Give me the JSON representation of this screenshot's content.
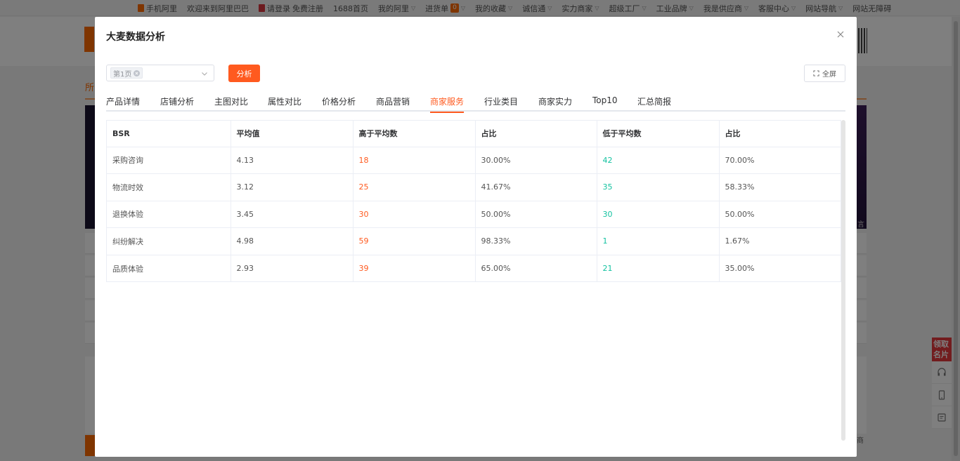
{
  "topbar": {
    "items": [
      "手机阿里",
      "欢迎来到阿里巴巴",
      "请登录",
      "免费注册",
      "1688首页",
      "我的阿里",
      "进货单",
      "我的收藏",
      "诚信通",
      "实力商家",
      "超级工厂",
      "工业品牌",
      "我是供应商",
      "客服中心",
      "网站导航",
      "网站无障碍"
    ],
    "cart_count": "0"
  },
  "background": {
    "tab_label": "所",
    "side_promo": "领取名片",
    "right_edge_label": "言",
    "bottom_right_label": "商"
  },
  "modal": {
    "title": "大麦数据分析",
    "page_select": {
      "tag": "第1页"
    },
    "analyze_label": "分析",
    "fullscreen_label": "全屏",
    "tabs": [
      {
        "label": "产品详情",
        "active": false
      },
      {
        "label": "店铺分析",
        "active": false
      },
      {
        "label": "主图对比",
        "active": false
      },
      {
        "label": "属性对比",
        "active": false
      },
      {
        "label": "价格分析",
        "active": false
      },
      {
        "label": "商品营销",
        "active": false
      },
      {
        "label": "商家服务",
        "active": true
      },
      {
        "label": "行业类目",
        "active": false
      },
      {
        "label": "商家实力",
        "active": false
      },
      {
        "label": "Top10",
        "active": false
      },
      {
        "label": "汇总简报",
        "active": false
      }
    ],
    "table": {
      "headers": [
        "BSR",
        "平均值",
        "高于平均数",
        "占比",
        "低于平均数",
        "占比"
      ],
      "rows": [
        [
          "采购咨询",
          "4.13",
          "18",
          "30.00%",
          "42",
          "70.00%"
        ],
        [
          "物流时效",
          "3.12",
          "25",
          "41.67%",
          "35",
          "58.33%"
        ],
        [
          "退换体验",
          "3.45",
          "30",
          "50.00%",
          "30",
          "50.00%"
        ],
        [
          "纠纷解决",
          "4.98",
          "59",
          "98.33%",
          "1",
          "1.67%"
        ],
        [
          "品质体验",
          "2.93",
          "39",
          "65.00%",
          "21",
          "35.00%"
        ]
      ]
    }
  },
  "colors": {
    "accent": "#ff5a1f",
    "above_avg": "#ff5a1f",
    "below_avg": "#13c2a0"
  }
}
